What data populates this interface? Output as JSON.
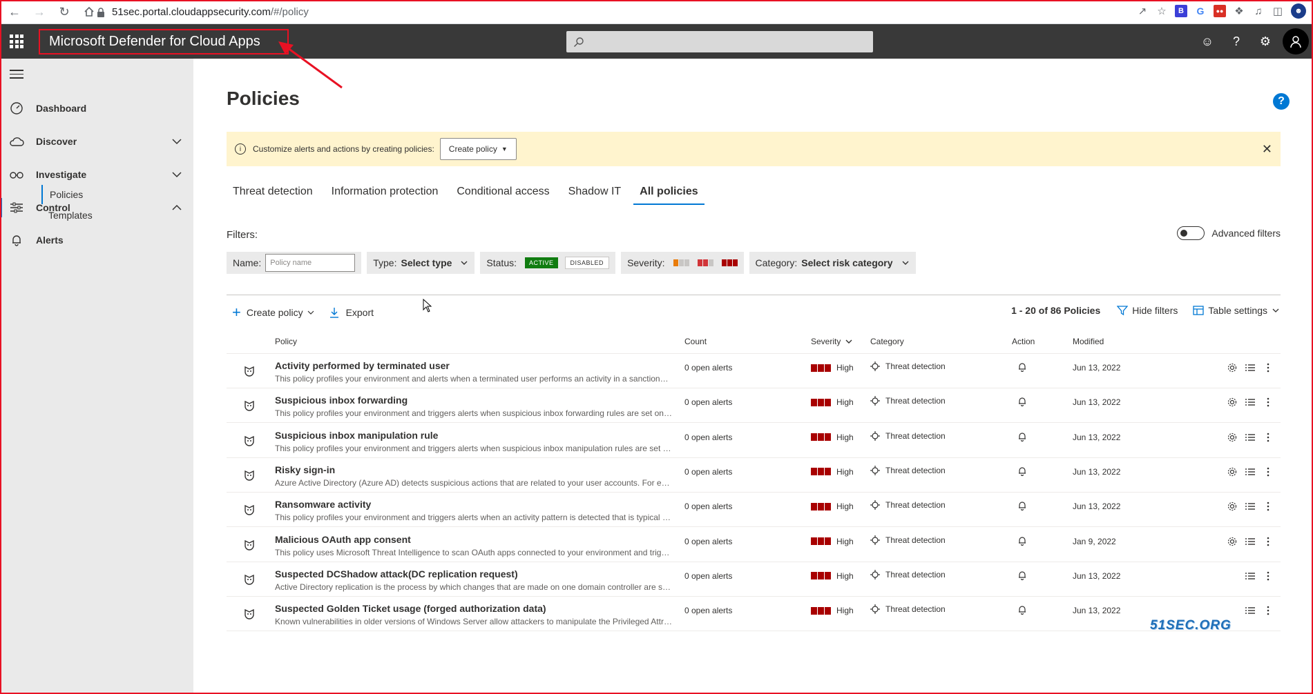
{
  "browser": {
    "url_host": "51sec.portal.cloudappsecurity.com",
    "url_path": "/#/policy"
  },
  "header": {
    "app_title": "Microsoft Defender for Cloud Apps"
  },
  "sidebar": {
    "items": [
      {
        "label": "Dashboard"
      },
      {
        "label": "Discover"
      },
      {
        "label": "Investigate"
      },
      {
        "label": "Control"
      },
      {
        "label": "Alerts"
      }
    ],
    "control_sub": [
      {
        "label": "Policies"
      },
      {
        "label": "Templates"
      }
    ]
  },
  "main": {
    "title": "Policies",
    "banner": {
      "text": "Customize alerts and actions by creating policies:",
      "button": "Create policy"
    },
    "tabs": [
      {
        "label": "Threat detection"
      },
      {
        "label": "Information protection"
      },
      {
        "label": "Conditional access"
      },
      {
        "label": "Shadow IT"
      },
      {
        "label": "All policies"
      }
    ],
    "filters": {
      "label": "Filters:",
      "advanced": "Advanced filters",
      "name_label": "Name:",
      "name_placeholder": "Policy name",
      "type_label": "Type:",
      "type_value": "Select type",
      "status_label": "Status:",
      "status_active": "ACTIVE",
      "status_disabled": "DISABLED",
      "severity_label": "Severity:",
      "category_label": "Category:",
      "category_value": "Select risk category"
    },
    "toolbar": {
      "create": "Create policy",
      "export": "Export",
      "count": "1 - 20 of 86 Policies",
      "hide_filters": "Hide filters",
      "table_settings": "Table settings"
    },
    "columns": {
      "policy": "Policy",
      "count": "Count",
      "severity": "Severity",
      "category": "Category",
      "action": "Action",
      "modified": "Modified"
    },
    "rows": [
      {
        "name": "Activity performed by terminated user",
        "desc": "This policy profiles your environment and alerts when a terminated user performs an activity in a sanctioned app.",
        "count": "0 open alerts",
        "severity": "High",
        "category": "Threat detection",
        "modified": "Jun 13, 2022"
      },
      {
        "name": "Suspicious inbox forwarding",
        "desc": "This policy profiles your environment and triggers alerts when suspicious inbox forwarding rules are set on a user's inbox.",
        "count": "0 open alerts",
        "severity": "High",
        "category": "Threat detection",
        "modified": "Jun 13, 2022"
      },
      {
        "name": "Suspicious inbox manipulation rule",
        "desc": "This policy profiles your environment and triggers alerts when suspicious inbox manipulation rules are set on a user's inbox.",
        "count": "0 open alerts",
        "severity": "High",
        "category": "Threat detection",
        "modified": "Jun 13, 2022"
      },
      {
        "name": "Risky sign-in",
        "desc": "Azure Active Directory (Azure AD) detects suspicious actions that are related to your user accounts. For each detected action.",
        "count": "0 open alerts",
        "severity": "High",
        "category": "Threat detection",
        "modified": "Jun 13, 2022"
      },
      {
        "name": "Ransomware activity",
        "desc": "This policy profiles your environment and triggers alerts when an activity pattern is detected that is typical of a ransomware attack.",
        "count": "0 open alerts",
        "severity": "High",
        "category": "Threat detection",
        "modified": "Jun 13, 2022"
      },
      {
        "name": "Malicious OAuth app consent",
        "desc": "This policy uses Microsoft Threat Intelligence to scan OAuth apps connected to your environment and triggers alerts.",
        "count": "0 open alerts",
        "severity": "High",
        "category": "Threat detection",
        "modified": "Jan 9, 2022"
      },
      {
        "name": "Suspected DCShadow attack(DC replication request)",
        "desc": "Active Directory replication is the process by which changes that are made on one domain controller are synchronized.",
        "count": "0 open alerts",
        "severity": "High",
        "category": "Threat detection",
        "modified": "Jun 13, 2022"
      },
      {
        "name": "Suspected Golden Ticket usage (forged authorization data)",
        "desc": "Known vulnerabilities in older versions of Windows Server allow attackers to manipulate the Privileged Attribute Certificate.",
        "count": "0 open alerts",
        "severity": "High",
        "category": "Threat detection",
        "modified": "Jun 13, 2022"
      }
    ]
  },
  "watermark": "51SEC.ORG",
  "colors": {
    "header_bg": "#393939",
    "accent": "#0078d4",
    "banner_bg": "#fff4ce",
    "active_green": "#107c10",
    "severity_high": "#a80000",
    "annotation_red": "#e81123"
  }
}
